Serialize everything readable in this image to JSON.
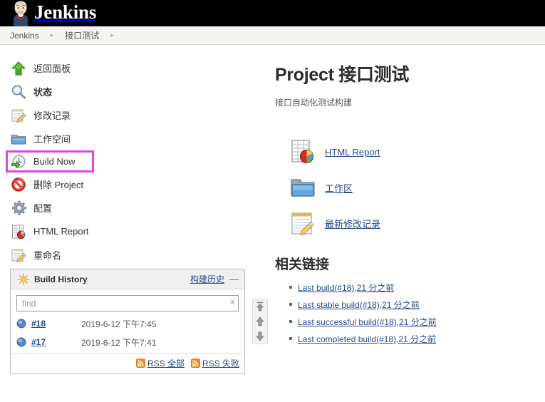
{
  "header": {
    "brand": "Jenkins",
    "logo_icon": "jenkins-butler-icon"
  },
  "breadcrumb": {
    "items": [
      "Jenkins",
      "接口测试"
    ],
    "separator": "▸"
  },
  "sidebar": {
    "tasks": [
      {
        "label": "返回面板",
        "icon": "up-arrow-icon",
        "bold": false,
        "highlighted": false
      },
      {
        "label": "状态",
        "icon": "magnifier-icon",
        "bold": true,
        "highlighted": false
      },
      {
        "label": "修改记录",
        "icon": "notepad-pencil-icon",
        "bold": false,
        "highlighted": false
      },
      {
        "label": "工作空间",
        "icon": "folder-icon",
        "bold": false,
        "highlighted": false
      },
      {
        "label": "Build Now",
        "icon": "build-clock-icon",
        "bold": false,
        "highlighted": true
      },
      {
        "label": "删除 Project",
        "icon": "delete-forbidden-icon",
        "bold": false,
        "highlighted": false
      },
      {
        "label": "配置",
        "icon": "gear-icon",
        "bold": false,
        "highlighted": false
      },
      {
        "label": "HTML Report",
        "icon": "report-chart-icon",
        "bold": false,
        "highlighted": false
      },
      {
        "label": "重命名",
        "icon": "notepad-pencil-icon",
        "bold": false,
        "highlighted": false
      }
    ],
    "highlight_color": "#e542e5"
  },
  "build_history": {
    "icon": "sun-icon",
    "title": "Build History",
    "zh_link": "构建历史",
    "collapse_label": "—",
    "find": {
      "placeholder": "find",
      "value": "",
      "clear_label": "x"
    },
    "builds": [
      {
        "status_icon": "blue-ball-icon",
        "number": "#18",
        "time": "2019-6-12 下午7:45"
      },
      {
        "status_icon": "blue-ball-icon",
        "number": "#17",
        "time": "2019-6-12 下午7:41"
      }
    ],
    "rss": [
      {
        "icon": "rss-icon",
        "label": "RSS 全部"
      },
      {
        "icon": "rss-icon",
        "label": "RSS 失败"
      }
    ],
    "scroll_buttons": [
      "scroll-top-icon",
      "scroll-up-icon",
      "scroll-down-icon"
    ]
  },
  "main": {
    "title": "Project 接口测试",
    "description": "接口自动化测试构建",
    "actions": [
      {
        "label": "HTML Report",
        "icon": "report-chart-icon"
      },
      {
        "label": "工作区",
        "icon": "folder-icon"
      },
      {
        "label": "最新修改记录",
        "icon": "notepad-pencil-icon"
      }
    ],
    "related_links_title": "相关链接",
    "related_links": [
      "Last build(#18),21 分之前",
      "Last stable build(#18),21 分之前",
      "Last successful build(#18),21 分之前",
      "Last completed build(#18),21 分之前"
    ]
  }
}
